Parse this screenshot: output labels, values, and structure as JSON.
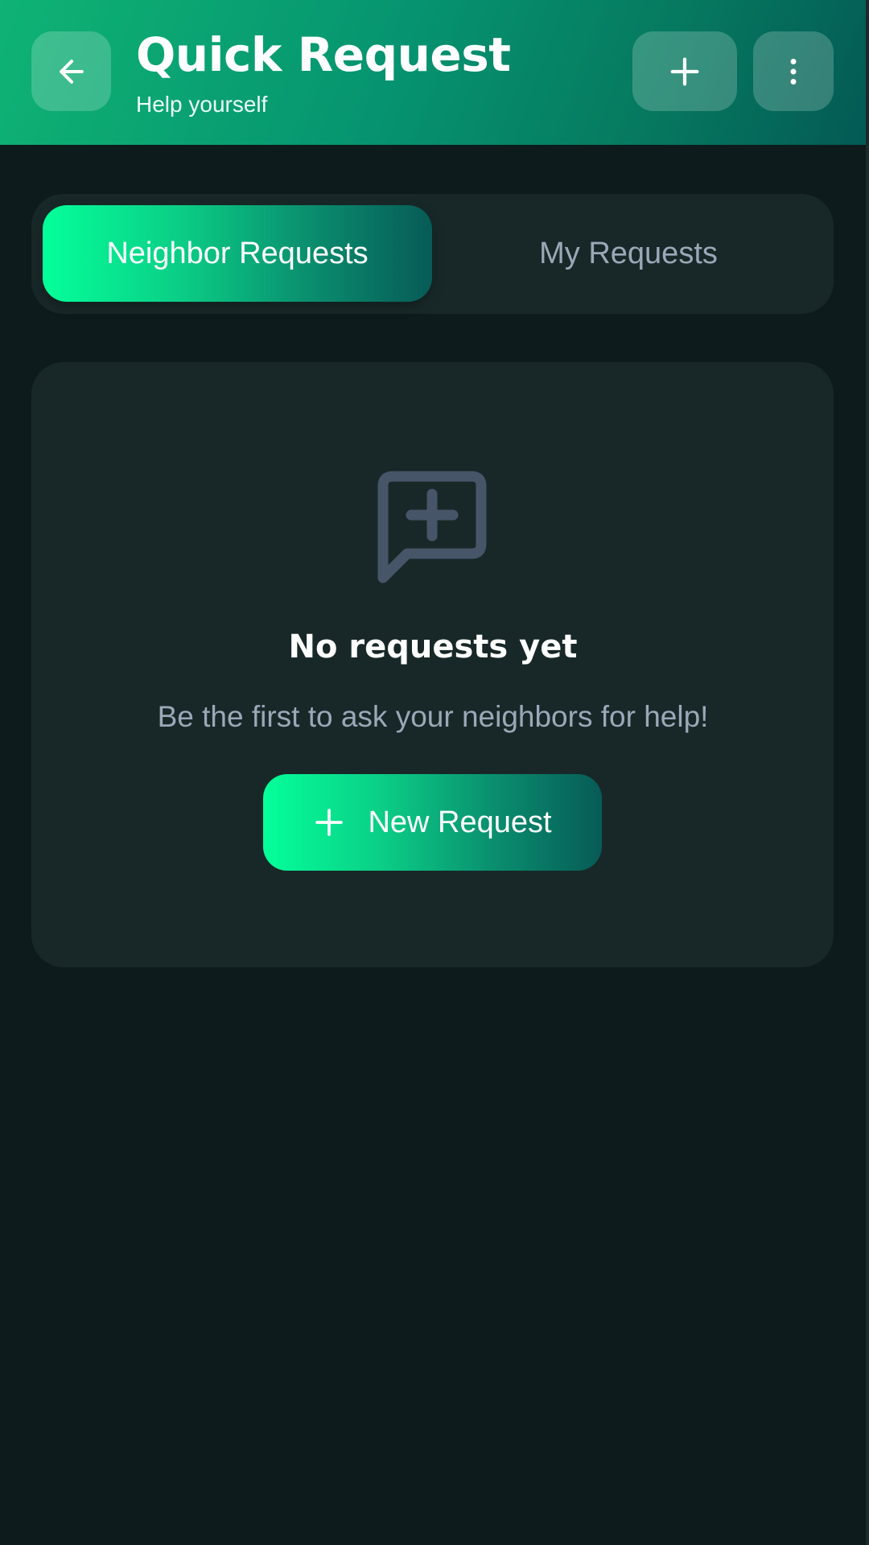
{
  "header": {
    "title": "Quick Request",
    "subtitle": "Help yourself",
    "back_icon": "arrow-left-icon",
    "add_icon": "plus-icon",
    "more_icon": "more-vertical-icon"
  },
  "tabs": [
    {
      "label": "Neighbor Requests",
      "active": true
    },
    {
      "label": "My Requests",
      "active": false
    }
  ],
  "empty_state": {
    "icon": "message-plus-icon",
    "title": "No requests yet",
    "description": "Be the first to ask your neighbors for help!",
    "button_label": "New Request",
    "button_icon": "plus-icon"
  },
  "colors": {
    "background": "#0d1b1c",
    "card": "#182828",
    "accent_start": "#04ff9a",
    "accent_end": "#075b57",
    "muted_text": "#9aa8b8",
    "empty_icon": "#475569"
  }
}
